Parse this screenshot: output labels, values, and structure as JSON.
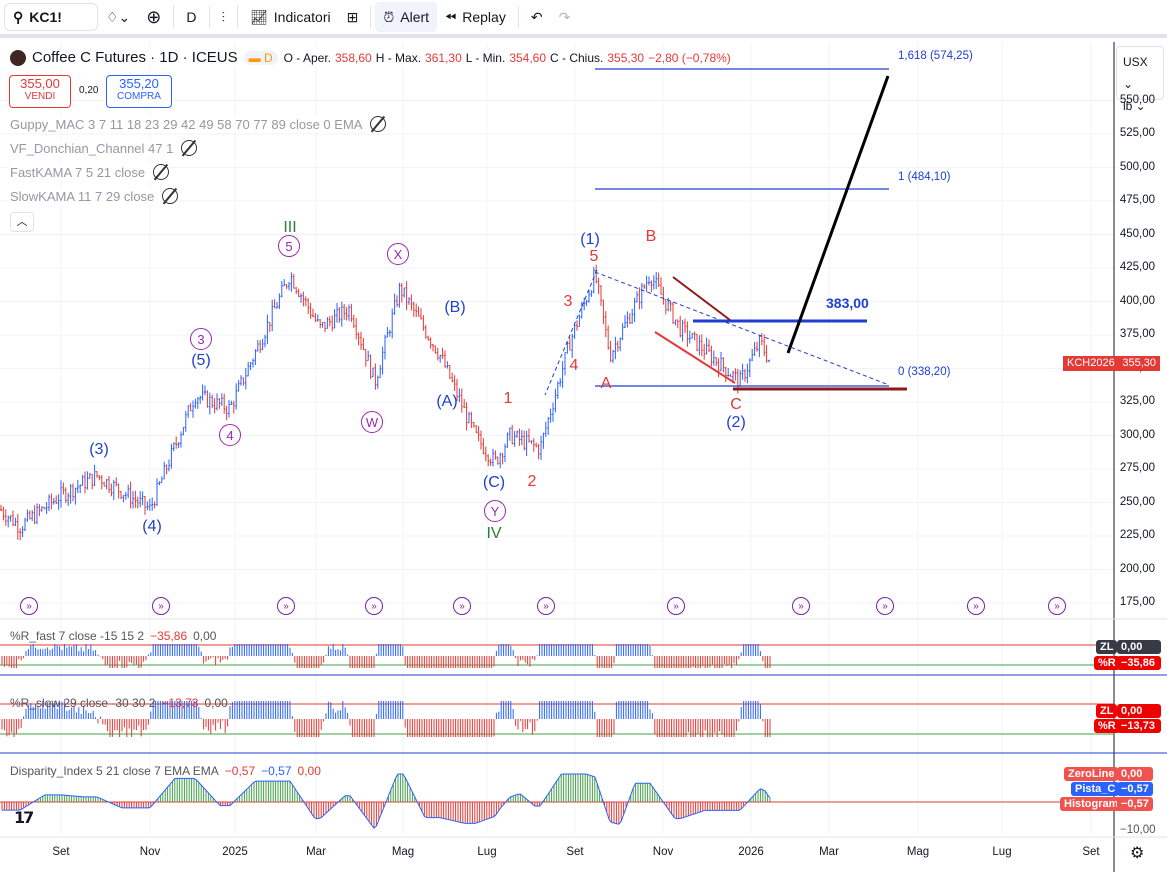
{
  "toolbar": {
    "symbol": "KC1!",
    "interval": "D",
    "indicators": "Indicatori",
    "alert": "Alert",
    "replay": "Replay"
  },
  "header": {
    "title": "Coffee C Futures · 1D · ICEUS",
    "badge": "D",
    "o_label": "O - Aper.",
    "o": "358,60",
    "h_label": "H - Max.",
    "h": "361,30",
    "l_label": "L - Min.",
    "l": "354,60",
    "c_label": "C - Chius.",
    "c": "355,30",
    "change": "−2,80 (−0,78%)"
  },
  "trade": {
    "sell_price": "355,00",
    "sell": "VENDI",
    "spread": "0,20",
    "buy_price": "355,20",
    "buy": "COMPRA"
  },
  "indicators": [
    "Guppy_MAC 3 7 11 18 23 29 42 49 58 70 77 89 close 0 EMA",
    "VF_Donchian_Channel 47 1",
    "FastKAMA 7 5 21 close",
    "SlowKAMA 11 7 29 close"
  ],
  "currency": "USX",
  "unit": "lb",
  "price_axis": [
    "550,00",
    "525,00",
    "500,00",
    "475,00",
    "450,00",
    "425,00",
    "400,00",
    "375,00",
    "350,00",
    "325,00",
    "300,00",
    "275,00",
    "250,00",
    "225,00",
    "200,00",
    "175,00"
  ],
  "price_tag": {
    "symbol": "KCH2026",
    "price": "355,30"
  },
  "fib": {
    "l1618": "1,618 (574,25)",
    "l1": "1 (484,10)",
    "l0": "0 (338,20)",
    "target": "383,00"
  },
  "wave_labels": [
    {
      "text": "III",
      "color": "#2e7d32"
    },
    {
      "text": "5",
      "color": "circ"
    },
    {
      "text": "X",
      "color": "circ"
    },
    {
      "text": "(B)",
      "color": "#1e3fd1"
    },
    {
      "text": "3",
      "color": "circ"
    },
    {
      "text": "(5)",
      "color": "#1e3fd1"
    },
    {
      "text": "4",
      "color": "circ"
    },
    {
      "text": "(3)",
      "color": "#1e3fd1"
    },
    {
      "text": "(4)",
      "color": "#1e3fd1"
    },
    {
      "text": "W",
      "color": "circ"
    },
    {
      "text": "(A)",
      "color": "#1e3fd1"
    },
    {
      "text": "1",
      "color": "#e53935"
    },
    {
      "text": "(C)",
      "color": "#1e3fd1"
    },
    {
      "text": "Y",
      "color": "circ"
    },
    {
      "text": "IV",
      "color": "#2e7d32"
    },
    {
      "text": "2",
      "color": "#e53935"
    },
    {
      "text": "3",
      "color": "#e53935"
    },
    {
      "text": "4",
      "color": "#e53935"
    },
    {
      "text": "5",
      "color": "#e53935"
    },
    {
      "text": "(1)",
      "color": "#1e3fd1"
    },
    {
      "text": "B",
      "color": "#e53935"
    },
    {
      "text": "A",
      "color": "#e53935"
    },
    {
      "text": "C",
      "color": "#e53935"
    },
    {
      "text": "(2)",
      "color": "#1e3fd1"
    }
  ],
  "panes": {
    "wr_fast": {
      "title": "%R_fast 7 close -15 15 2",
      "v1": "−35,86",
      "v2": "0,00",
      "zl_label": "ZL",
      "zl": "0,00",
      "r_label": "%R",
      "r": "−35,86"
    },
    "wr_slow": {
      "title": "%R_slow 29 close -30 30 2",
      "v1": "−13,73",
      "v2": "0,00",
      "zl_label": "ZL",
      "zl": "0,00",
      "r_label": "%R",
      "r": "−13,73"
    },
    "disp": {
      "title": "Disparity_Index 5 21 close 7 EMA EMA",
      "v1": "−0,57",
      "v2": "−0,57",
      "v3": "0,00",
      "zero_label": "ZeroLine",
      "zero": "0,00",
      "pista_label": "Pista_C",
      "pista": "−0,57",
      "hist_label": "Histogram",
      "hist": "−0,57",
      "axis": "−10,00"
    }
  },
  "time_axis": [
    "Set",
    "Nov",
    "2025",
    "Mar",
    "Mag",
    "Lug",
    "Set",
    "Nov",
    "2026",
    "Mar",
    "Mag",
    "Lug",
    "Set"
  ],
  "colors": {
    "up": "#2962ff",
    "down": "#e53935",
    "fib": "#1e3fd1"
  }
}
